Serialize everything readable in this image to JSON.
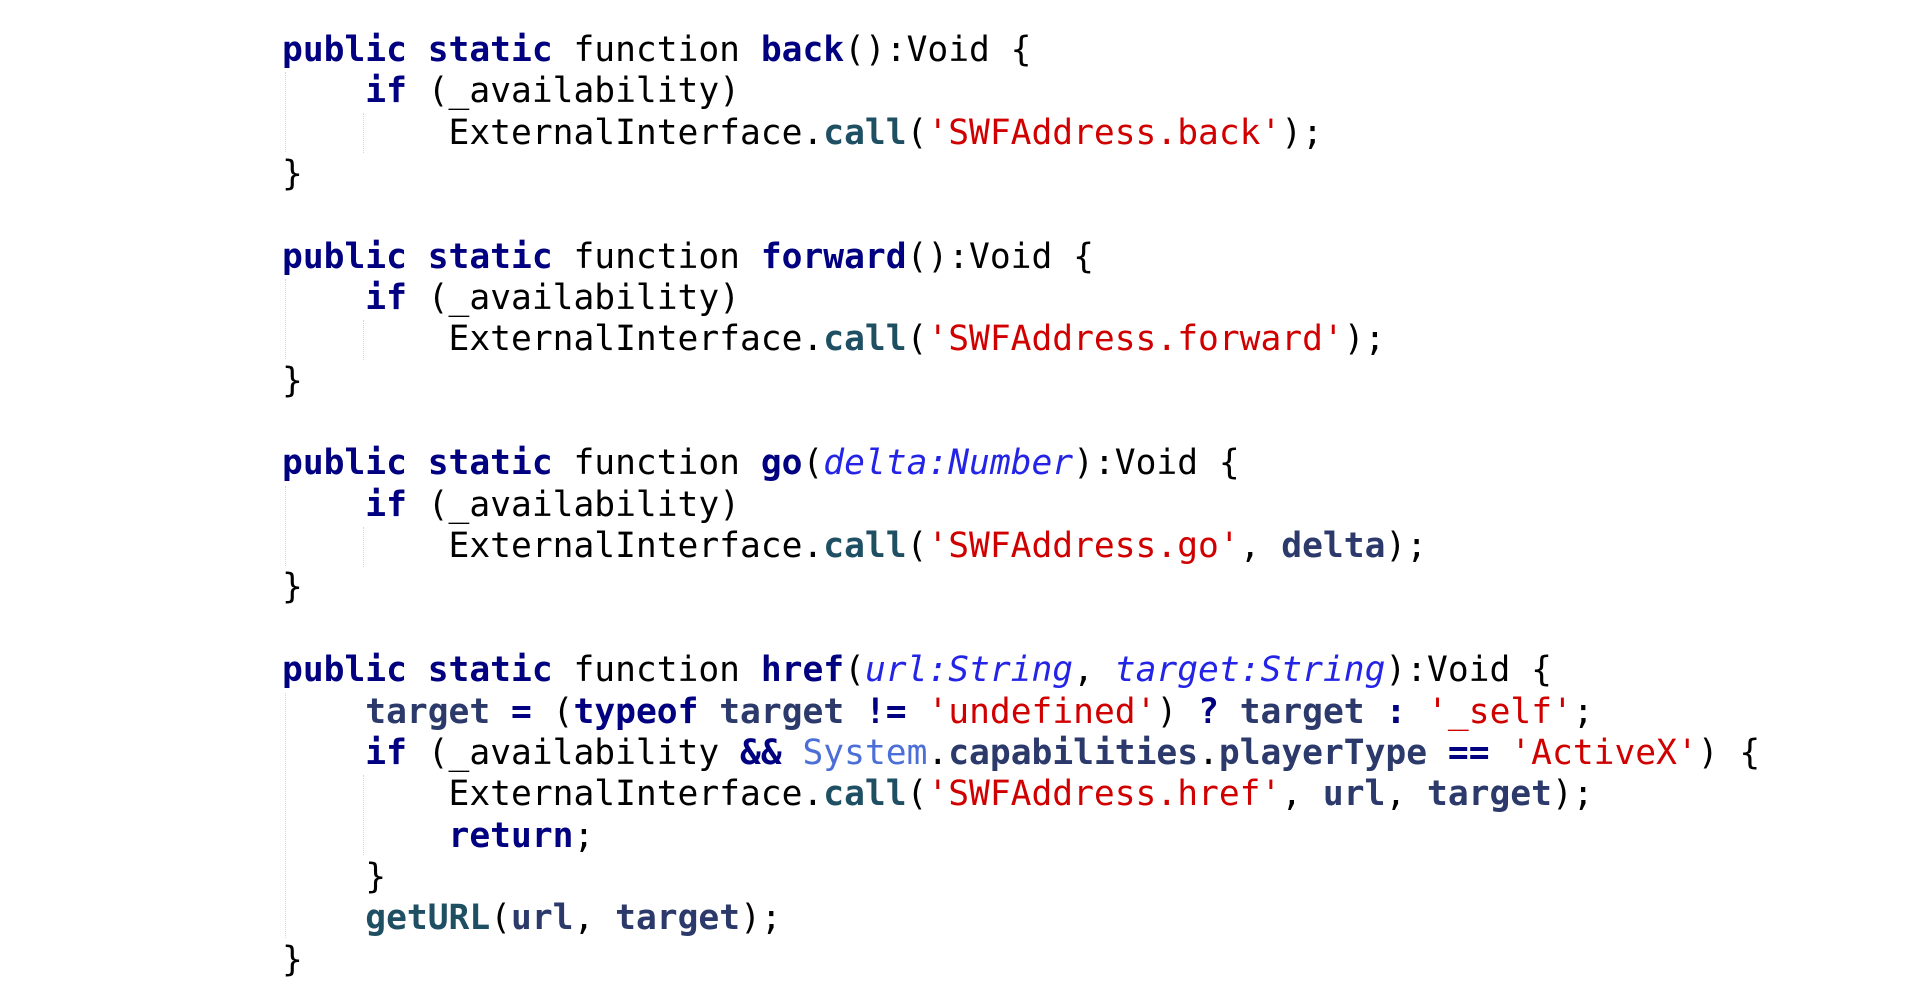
{
  "editor": {
    "lines": [
      [
        [
          "kw",
          "public static "
        ],
        [
          "plain",
          "function "
        ],
        [
          "fn",
          "back"
        ],
        [
          "plain",
          "():Void {"
        ]
      ],
      [
        [
          "plain",
          "    "
        ],
        [
          "kw",
          "if"
        ],
        [
          "plain",
          " (_availability)"
        ]
      ],
      [
        [
          "plain",
          "        ExternalInterface."
        ],
        [
          "call",
          "call"
        ],
        [
          "plain",
          "("
        ],
        [
          "str",
          "'SWFAddress.back'"
        ],
        [
          "plain",
          ");"
        ]
      ],
      [
        [
          "plain",
          "}"
        ]
      ],
      [
        [
          "plain",
          ""
        ]
      ],
      [
        [
          "kw",
          "public static "
        ],
        [
          "plain",
          "function "
        ],
        [
          "fn",
          "forward"
        ],
        [
          "plain",
          "():Void {"
        ]
      ],
      [
        [
          "plain",
          "    "
        ],
        [
          "kw",
          "if"
        ],
        [
          "plain",
          " (_availability)"
        ]
      ],
      [
        [
          "plain",
          "        ExternalInterface."
        ],
        [
          "call",
          "call"
        ],
        [
          "plain",
          "("
        ],
        [
          "str",
          "'SWFAddress.forward'"
        ],
        [
          "plain",
          ");"
        ]
      ],
      [
        [
          "plain",
          "}"
        ]
      ],
      [
        [
          "plain",
          ""
        ]
      ],
      [
        [
          "kw",
          "public static "
        ],
        [
          "plain",
          "function "
        ],
        [
          "fn",
          "go"
        ],
        [
          "plain",
          "("
        ],
        [
          "param",
          "delta:Number"
        ],
        [
          "plain",
          "):Void {"
        ]
      ],
      [
        [
          "plain",
          "    "
        ],
        [
          "kw",
          "if"
        ],
        [
          "plain",
          " (_availability)"
        ]
      ],
      [
        [
          "plain",
          "        ExternalInterface."
        ],
        [
          "call",
          "call"
        ],
        [
          "plain",
          "("
        ],
        [
          "str",
          "'SWFAddress.go'"
        ],
        [
          "plain",
          ", "
        ],
        [
          "var",
          "delta"
        ],
        [
          "plain",
          ");"
        ]
      ],
      [
        [
          "plain",
          "}"
        ]
      ],
      [
        [
          "plain",
          ""
        ]
      ],
      [
        [
          "kw",
          "public static "
        ],
        [
          "plain",
          "function "
        ],
        [
          "fn",
          "href"
        ],
        [
          "plain",
          "("
        ],
        [
          "param",
          "url:String"
        ],
        [
          "plain",
          ", "
        ],
        [
          "param",
          "target:String"
        ],
        [
          "plain",
          "):Void {"
        ]
      ],
      [
        [
          "plain",
          "    "
        ],
        [
          "var",
          "target"
        ],
        [
          "op",
          " = "
        ],
        [
          "plain",
          "("
        ],
        [
          "kw",
          "typeof "
        ],
        [
          "var",
          "target"
        ],
        [
          "op",
          " != "
        ],
        [
          "str",
          "'undefined'"
        ],
        [
          "plain",
          ") "
        ],
        [
          "op",
          "? "
        ],
        [
          "var",
          "target"
        ],
        [
          "op",
          " : "
        ],
        [
          "str",
          "'_self'"
        ],
        [
          "plain",
          ";"
        ]
      ],
      [
        [
          "plain",
          "    "
        ],
        [
          "kw",
          "if"
        ],
        [
          "plain",
          " (_availability "
        ],
        [
          "op",
          "&& "
        ],
        [
          "class",
          "System"
        ],
        [
          "plain",
          "."
        ],
        [
          "var",
          "capabilities"
        ],
        [
          "plain",
          "."
        ],
        [
          "var",
          "playerType"
        ],
        [
          "op",
          " == "
        ],
        [
          "str",
          "'ActiveX'"
        ],
        [
          "plain",
          ") {"
        ]
      ],
      [
        [
          "plain",
          "        ExternalInterface."
        ],
        [
          "call",
          "call"
        ],
        [
          "plain",
          "("
        ],
        [
          "str",
          "'SWFAddress.href'"
        ],
        [
          "plain",
          ", "
        ],
        [
          "var",
          "url"
        ],
        [
          "plain",
          ", "
        ],
        [
          "var",
          "target"
        ],
        [
          "plain",
          ");"
        ]
      ],
      [
        [
          "plain",
          "        "
        ],
        [
          "kw",
          "return"
        ],
        [
          "plain",
          ";"
        ]
      ],
      [
        [
          "plain",
          "    }"
        ]
      ],
      [
        [
          "plain",
          "    "
        ],
        [
          "call",
          "getURL"
        ],
        [
          "plain",
          "("
        ],
        [
          "var",
          "url"
        ],
        [
          "plain",
          ", "
        ],
        [
          "var",
          "target"
        ],
        [
          "plain",
          ");"
        ]
      ],
      [
        [
          "plain",
          "}"
        ]
      ]
    ],
    "colors": {
      "background": "#ffffff",
      "keyword": "#000080",
      "string": "#d00000",
      "parameter": "#2424e6",
      "class": "#4b6fd6",
      "variable": "#2c3a6b"
    }
  }
}
